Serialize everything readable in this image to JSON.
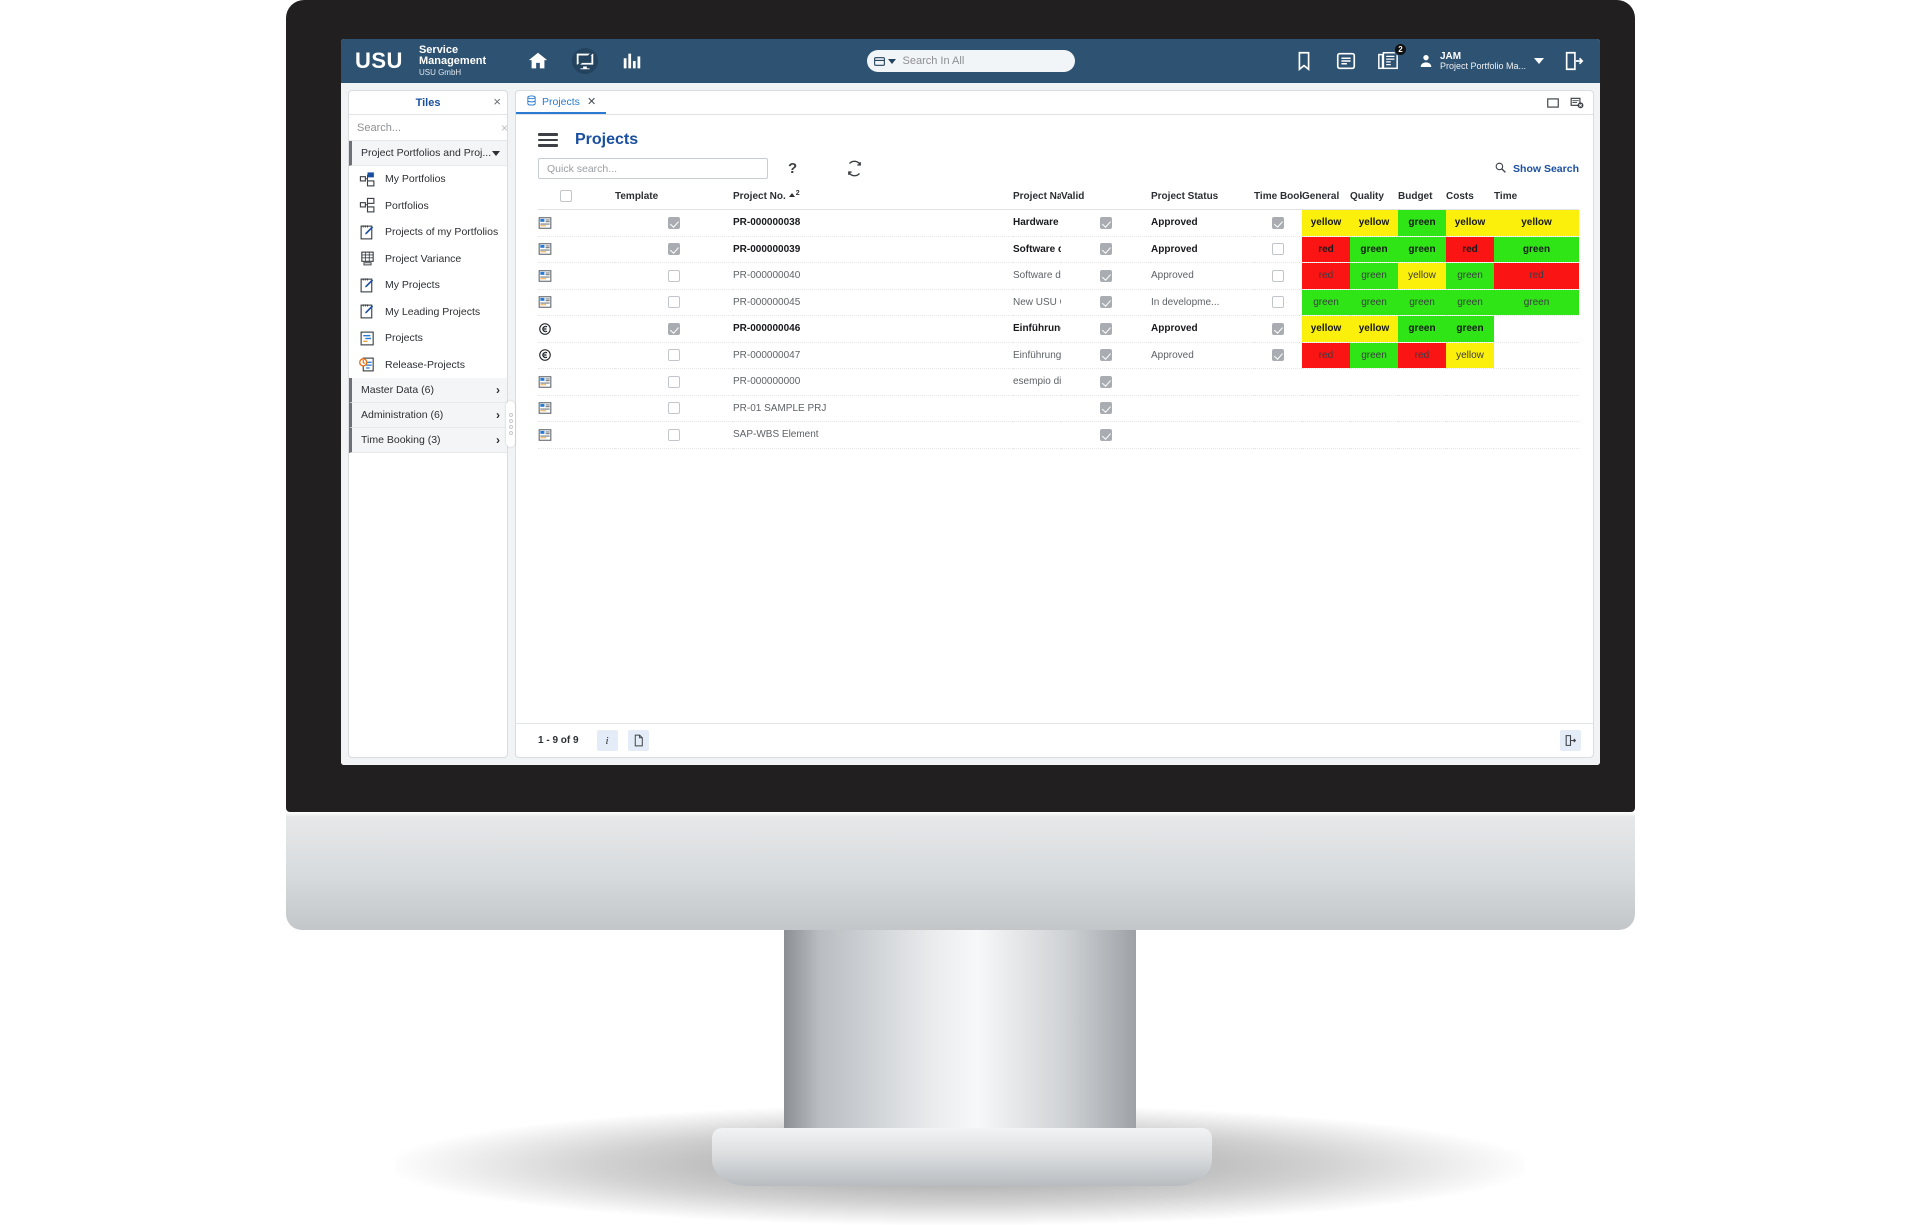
{
  "header": {
    "logo": "USU",
    "brand_line1": "Service",
    "brand_line2": "Management",
    "brand_line3": "USU GmbH",
    "icons": [
      "home-icon",
      "monitor-icon",
      "chart-icon"
    ],
    "search": {
      "placeholder": "Search In All",
      "value": "",
      "type_icon": "scope-selector-icon"
    },
    "right_icons": [
      "bookmark-icon",
      "list-icon",
      "news-icon"
    ],
    "news_badge": "2",
    "user": {
      "name": "JAM",
      "role": "Project Portfolio Ma...",
      "avatar": "user-avatar-icon"
    },
    "logout_icon": "logout-icon",
    "bar_color": "#2e5272"
  },
  "sidebar": {
    "title": "Tiles",
    "close_label": "×",
    "search": {
      "placeholder": "Search...",
      "value": "",
      "clear_label": "×"
    },
    "group_open": {
      "label": "Project Portfolios and Proj...",
      "state": "expanded"
    },
    "items": [
      {
        "label": "My Portfolios",
        "icon": "portfolio-filled-icon"
      },
      {
        "label": "Portfolios",
        "icon": "portfolio-icon"
      },
      {
        "label": "Projects of my Portfolios",
        "icon": "project-pencil-icon"
      },
      {
        "label": "Project Variance",
        "icon": "grid-table-icon"
      },
      {
        "label": "My Projects",
        "icon": "project-pencil-icon"
      },
      {
        "label": "My Leading Projects",
        "icon": "project-pencil-icon"
      },
      {
        "label": "Projects",
        "icon": "gantt-icon"
      },
      {
        "label": "Release-Projects",
        "icon": "release-refresh-icon"
      }
    ],
    "groups": [
      {
        "label": "Master Data (6)",
        "chevron": "chevron-right-icon"
      },
      {
        "label": "Administration (6)",
        "chevron": "chevron-right-icon"
      },
      {
        "label": "Time Booking (3)",
        "chevron": "chevron-right-icon"
      }
    ]
  },
  "content": {
    "tab": {
      "label": "Projects",
      "icon": "database-icon",
      "close": "✕"
    },
    "tab_right_icons": [
      "restore-window-icon",
      "reset-view-icon"
    ],
    "page_title": "Projects",
    "menu_icon": "hamburger-icon",
    "quick_search": {
      "placeholder": "Quick search...",
      "value": ""
    },
    "help_label": "?",
    "refresh_icon": "refresh-icon",
    "show_search": {
      "label": "Show Search",
      "icon": "search-icon"
    },
    "footer": {
      "count": "1 - 9 of 9",
      "info_label": "i",
      "doc_icon": "document-icon",
      "export_icon": "export-icon"
    }
  },
  "table": {
    "columns": [
      "Template",
      "Project No.",
      "Project Name",
      "Valid",
      "Project Status",
      "Time Booking Allow...",
      "General",
      "Quality",
      "Budget",
      "Costs",
      "Time"
    ],
    "sort": {
      "column": "Project No.",
      "direction": "asc",
      "order": "2"
    },
    "select_all": false,
    "rows": [
      {
        "row_icon": "project-doc-icon",
        "template": true,
        "bold": true,
        "project_no": "PR-000000038",
        "project_name": "Hardware Rollout for new building",
        "valid": true,
        "status": "Approved",
        "time_booking": true,
        "general": "yellow",
        "quality": "yellow",
        "budget": "green",
        "costs": "yellow",
        "time": "yellow"
      },
      {
        "row_icon": "project-doc-icon",
        "template": true,
        "bold": true,
        "project_no": "PR-000000039",
        "project_name": "Software distribution for DE & CZ",
        "valid": true,
        "status": "Approved",
        "time_booking": false,
        "general": "red",
        "quality": "green",
        "budget": "green",
        "costs": "red",
        "time": "green"
      },
      {
        "row_icon": "project-doc-icon",
        "template": false,
        "bold": false,
        "project_no": "PR-000000040",
        "project_name": "Software distribution for US",
        "valid": true,
        "status": "Approved",
        "time_booking": false,
        "general": "red",
        "quality": "green",
        "budget": "yellow",
        "costs": "green",
        "time": "red"
      },
      {
        "row_icon": "project-doc-icon",
        "template": false,
        "bold": false,
        "project_no": "PR-000000045",
        "project_name": "New USU Campus in Hamburg",
        "valid": true,
        "status": "In developme...",
        "time_booking": false,
        "general": "green",
        "quality": "green",
        "budget": "green",
        "costs": "green",
        "time": "green"
      },
      {
        "row_icon": "euro-circle-icon",
        "template": true,
        "bold": true,
        "project_no": "PR-000000046",
        "project_name": "Einführung USU SM/Implementation USU SM",
        "valid": true,
        "status": "Approved",
        "time_booking": true,
        "general": "yellow",
        "quality": "yellow",
        "budget": "green",
        "costs": "green",
        "time": ""
      },
      {
        "row_icon": "euro-circle-icon",
        "template": false,
        "bold": false,
        "project_no": "PR-000000047",
        "project_name": "Einführung USU Knowledge Management inkl. Chatbots",
        "valid": true,
        "status": "Approved",
        "time_booking": true,
        "general": "red",
        "quality": "green",
        "budget": "red",
        "costs": "yellow",
        "time": ""
      },
      {
        "row_icon": "project-doc-icon",
        "template": false,
        "bold": false,
        "project_no": "PR-000000000",
        "project_name": "esempio di progetto",
        "valid": true,
        "status": "",
        "time_booking": null,
        "general": "",
        "quality": "",
        "budget": "",
        "costs": "",
        "time": ""
      },
      {
        "row_icon": "project-doc-icon",
        "template": false,
        "bold": false,
        "project_no": "PR-01 SAMPLE PRJ",
        "project_name": "",
        "valid": true,
        "status": "",
        "time_booking": null,
        "general": "",
        "quality": "",
        "budget": "",
        "costs": "",
        "time": ""
      },
      {
        "row_icon": "project-doc-icon",
        "template": false,
        "bold": false,
        "project_no": "SAP-WBS Element",
        "project_name": "",
        "valid": true,
        "status": "",
        "time_booking": null,
        "general": "",
        "quality": "",
        "budget": "",
        "costs": "",
        "time": ""
      }
    ]
  },
  "colors": {
    "header_bar": "#2e5272",
    "accent_blue": "#1a4fa0",
    "tab_blue": "#2a7ad1",
    "status_green": "#30e515",
    "status_yellow": "#fbf00c",
    "status_red": "#fb1414",
    "bezel": "#211f1f"
  }
}
